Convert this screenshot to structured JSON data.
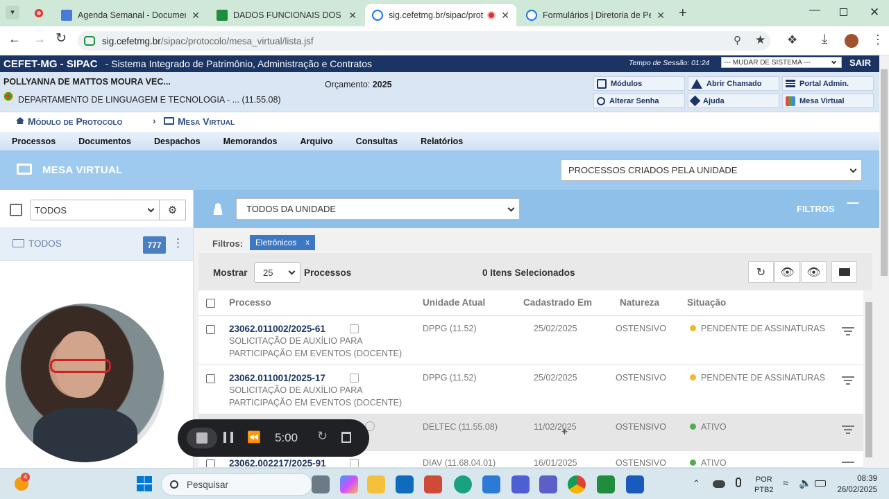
{
  "browser": {
    "tabs": [
      {
        "title": "Agenda Semanal - Documento",
        "color": "#4a7ad8"
      },
      {
        "title": "DADOS FUNCIONAIS DOS PROF",
        "color": "#1e8e3e"
      },
      {
        "title": "sig.cefetmg.br/sipac/protoc",
        "color": "#1a73e8"
      },
      {
        "title": "Formulários | Diretoria de Pesq",
        "color": "#1a73e8"
      }
    ],
    "url_host": "sig.cefetmg.br",
    "url_path": "/sipac/protocolo/mesa_virtual/lista.jsf"
  },
  "header": {
    "brand": "CEFET-MG - SIPAC",
    "system_name": "- Sistema Integrado de Patrimônio, Administração e Contratos",
    "session_label": "Tempo de Sessão:",
    "session_time": "01:24",
    "system_select": "--- MUDAR DE SISTEMA ---",
    "logout": "SAIR"
  },
  "user": {
    "name": "POLLYANNA DE MATTOS MOURA VEC...",
    "department": "DEPARTAMENTO DE LINGUAGEM E TECNOLOGIA - ... (11.55.08)",
    "budget_label": "Orçamento:",
    "budget_year": "2025"
  },
  "quick_links": {
    "modulos": "Módulos",
    "abrir_chamado": "Abrir Chamado",
    "portal_admin": "Portal Admin.",
    "alterar_senha": "Alterar Senha",
    "ajuda": "Ajuda",
    "mesa_virtual": "Mesa Virtual"
  },
  "breadcrumb": {
    "module": "Módulo de Protocolo",
    "page": "Mesa Virtual"
  },
  "menu": [
    "Processos",
    "Documentos",
    "Despachos",
    "Memorandos",
    "Arquivo",
    "Consultas",
    "Relatórios"
  ],
  "mesa": {
    "title": "MESA VIRTUAL",
    "view_select": "PROCESSOS CRIADOS PELA UNIDADE"
  },
  "left_panel": {
    "select_value": "TODOS",
    "folder_label": "TODOS",
    "folder_count": "777"
  },
  "filter_bar": {
    "unit_select": "TODOS DA UNIDADE",
    "filters_label": "FILTROS"
  },
  "filters": {
    "label": "Filtros:",
    "chip": "Eletrônicos",
    "chip_remove": "x"
  },
  "list_controls": {
    "show_label": "Mostrar",
    "page_size": "25",
    "unit_label": "Processos",
    "selected": "0 Itens Selecionados"
  },
  "table": {
    "headers": {
      "processo": "Processo",
      "unidade": "Unidade Atual",
      "cadastrado": "Cadastrado Em",
      "natureza": "Natureza",
      "situacao": "Situação"
    },
    "rows": [
      {
        "numero": "23062.011002/2025-61",
        "descricao_1": "SOLICITAÇÃO DE AUXÍLIO PARA",
        "descricao_2": "PARTICIPAÇÃO EM EVENTOS (DOCENTE)",
        "unidade": "DPPG (11.52)",
        "data": "25/02/2025",
        "natureza": "OSTENSIVO",
        "situacao": "PENDENTE DE ASSINATURAS",
        "status_color": "#f0b92a"
      },
      {
        "numero": "23062.011001/2025-17",
        "descricao_1": "SOLICITAÇÃO DE AUXÍLIO PARA",
        "descricao_2": "PARTICIPAÇÃO EM EVENTOS (DOCENTE)",
        "unidade": "DPPG (11.52)",
        "data": "25/02/2025",
        "natureza": "OSTENSIVO",
        "situacao": "PENDENTE DE ASSINATURAS",
        "status_color": "#f0b92a"
      },
      {
        "numero": "",
        "descricao_1": "",
        "descricao_2": "",
        "unidade": "DELTEC (11.55.08)",
        "data": "11/02/2025",
        "natureza": "OSTENSIVO",
        "situacao": "ATIVO",
        "status_color": "#4caf50"
      },
      {
        "numero": "23062.002217/2025-91",
        "descricao_1": "",
        "descricao_2": "",
        "unidade": "DIAV (11.68.04.01)",
        "data": "16/01/2025",
        "natureza": "OSTENSIVO",
        "situacao": "ATIVO",
        "status_color": "#4caf50"
      }
    ]
  },
  "recorder": {
    "time": "5:00"
  },
  "taskbar": {
    "search_placeholder": "Pesquisar",
    "notification_count": "4",
    "language": "POR",
    "layout": "PTB2",
    "time": "08:39",
    "date": "26/02/2025"
  }
}
